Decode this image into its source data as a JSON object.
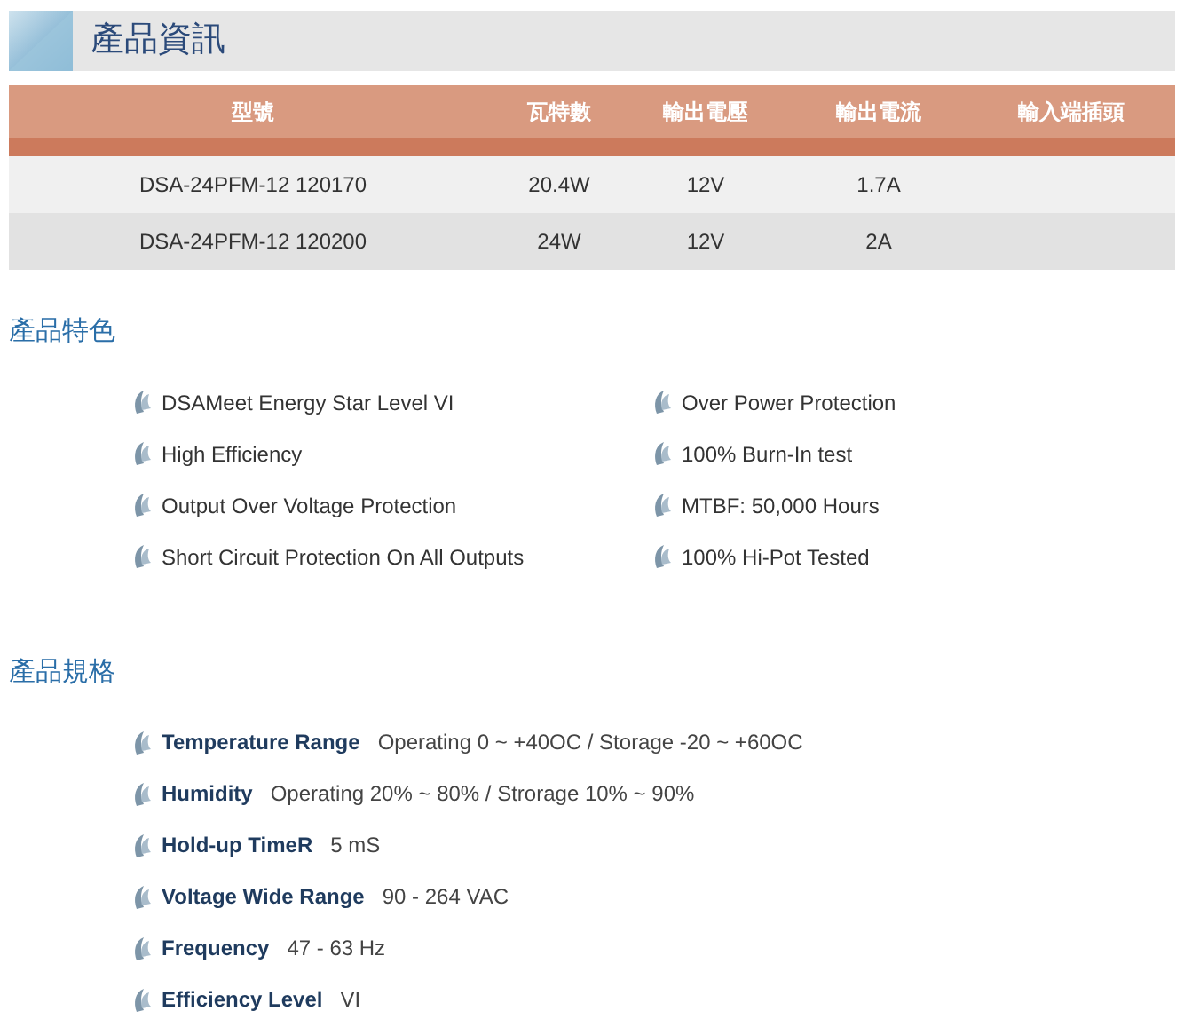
{
  "header": {
    "title": "產品資訊"
  },
  "table": {
    "columns": [
      "型號",
      "瓦特數",
      "輸出電壓",
      "輸出電流",
      "輸入端插頭"
    ],
    "rows": [
      [
        "DSA-24PFM-12 120170",
        "20.4W",
        "12V",
        "1.7A"
      ],
      [
        "DSA-24PFM-12 120200",
        "24W",
        "12V",
        "2A"
      ]
    ]
  },
  "features": {
    "title": "產品特色",
    "items": [
      "DSAMeet Energy Star Level VI",
      "Over Power Protection",
      "High Efficiency",
      "100% Burn-In test",
      "Output Over Voltage Protection",
      "MTBF: 50,000 Hours",
      "Short Circuit Protection On All Outputs",
      "100% Hi-Pot Tested"
    ]
  },
  "specs": {
    "title": "產品規格",
    "items": [
      {
        "label": "Temperature Range",
        "value": "Operating 0 ~ +40OC / Storage -20 ~ +60OC"
      },
      {
        "label": "Humidity",
        "value": "Operating 20% ~ 80% / Strorage 10% ~ 90%"
      },
      {
        "label": "Hold-up TimeR",
        "value": "5 mS"
      },
      {
        "label": "Voltage Wide Range",
        "value": "90 - 264 VAC"
      },
      {
        "label": "Frequency",
        "value": "47 - 63 Hz"
      },
      {
        "label": "Efficiency Level",
        "value": "VI"
      }
    ]
  }
}
